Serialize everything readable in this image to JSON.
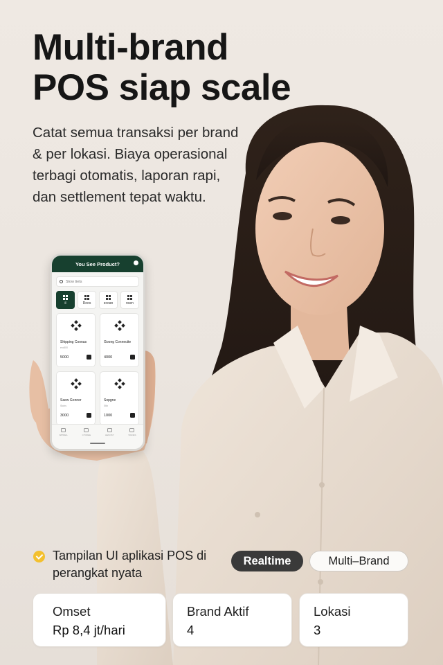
{
  "headline": {
    "line1": "Multi-brand",
    "line2": "POS siap scale"
  },
  "subtext": "Catat semua transaksi per brand & per lokasi. Biaya operasional terbagi otomatis, laporan rapi, dan settlement tepat waktu.",
  "phone_app": {
    "header_title": "You See Product?",
    "search_placeholder": "Slow tiets",
    "categories": [
      {
        "label": "il",
        "active": true
      },
      {
        "label": "Roos",
        "active": false
      },
      {
        "label": "ecoan",
        "active": false
      },
      {
        "label": "nsen",
        "active": false
      }
    ],
    "products": [
      {
        "name": "Shipping Coonas",
        "sub": "ero800",
        "price": "5000"
      },
      {
        "name": "Goong Connectte",
        "sub": "",
        "price": "4000"
      },
      {
        "name": "Saew Gonner",
        "sub": "Stobs",
        "price": "3000"
      },
      {
        "name": "Sopgne",
        "sub": "Stib",
        "price": "1000"
      }
    ],
    "nav": [
      "WIPREIL",
      "CTOREE",
      "HENOST",
      "SWOES"
    ]
  },
  "note": "Tampilan UI aplikasi POS di perangkat nyata",
  "tags": {
    "realtime": "Realtime",
    "multibrand": "Multi–Brand"
  },
  "stats": {
    "omset": {
      "label": "Omset",
      "value": "Rp 8,4 jt/hari"
    },
    "brand": {
      "label": "Brand Aktif",
      "value": "4"
    },
    "lokasi": {
      "label": "Lokasi",
      "value": "3"
    }
  },
  "colors": {
    "background": "#ebe5df",
    "app_header": "#17402f",
    "check_badge": "#f3c02e",
    "pill_dark": "#3a3a3a",
    "shirt": "#eadfd3",
    "hair": "#2a1e17"
  },
  "icons": [
    "check-circle-icon",
    "search-icon",
    "settings-icon",
    "grid-icon",
    "product-icon",
    "plus-icon",
    "nav-icon"
  ]
}
